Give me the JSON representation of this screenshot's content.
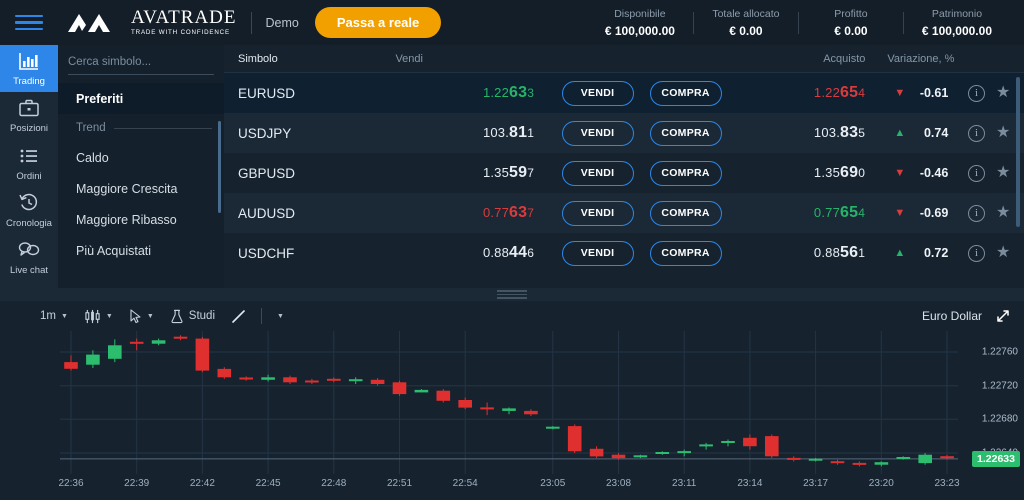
{
  "topbar": {
    "menu_icon": "hamburger-icon",
    "brand": "AVATRADE",
    "brand_tagline": "TRADE WITH CONFIDENCE",
    "account_mode": "Demo",
    "cta_label": "Passa a reale",
    "stats": [
      {
        "label": "Disponibile",
        "value": "€ 100,000.00"
      },
      {
        "label": "Totale allocato",
        "value": "€ 0.00"
      },
      {
        "label": "Profitto",
        "value": "€ 0.00"
      },
      {
        "label": "Patrimonio",
        "value": "€ 100,000.00"
      }
    ]
  },
  "leftnav": {
    "items": [
      {
        "label": "Trading",
        "icon": "bar-chart-icon",
        "active": true
      },
      {
        "label": "Posizioni",
        "icon": "briefcase-icon",
        "active": false
      },
      {
        "label": "Ordini",
        "icon": "list-icon",
        "active": false
      },
      {
        "label": "Cronologia",
        "icon": "history-clock-icon",
        "active": false
      }
    ],
    "chat": {
      "label": "Live chat",
      "icon": "chat-bubbles-icon"
    }
  },
  "watchlist": {
    "search_placeholder": "Cerca simbolo...",
    "search_value": "",
    "search_icon": "search-icon",
    "selected": "Preferiti",
    "group_label": "Trend",
    "items": [
      {
        "label": "Preferiti",
        "selected": true
      },
      {
        "label": "Caldo",
        "selected": false
      },
      {
        "label": "Maggiore Crescita",
        "selected": false
      },
      {
        "label": "Maggiore Ribasso",
        "selected": false
      },
      {
        "label": "Più Acquistati",
        "selected": false
      }
    ]
  },
  "quotes": {
    "headers": {
      "symbol": "Simbolo",
      "sell": "Vendi",
      "buy": "Acquisto",
      "change": "Variazione, %"
    },
    "sell_label": "VENDI",
    "buy_label": "COMPRA",
    "info_icon": "info-icon",
    "star_icon": "star-icon",
    "rows": [
      {
        "symbol": "EURUSD",
        "sell": {
          "pre": "1.22",
          "big": "63",
          "post": "3",
          "dir": "up"
        },
        "buy": {
          "pre": "1.22",
          "big": "65",
          "post": "4",
          "dir": "down"
        },
        "change": "-0.61",
        "change_dir": "down",
        "selected": true
      },
      {
        "symbol": "USDJPY",
        "sell": {
          "pre": "103.",
          "big": "81",
          "post": "1",
          "dir": "flat"
        },
        "buy": {
          "pre": "103.",
          "big": "83",
          "post": "5",
          "dir": "flat"
        },
        "change": "0.74",
        "change_dir": "up",
        "selected": false
      },
      {
        "symbol": "GBPUSD",
        "sell": {
          "pre": "1.35",
          "big": "59",
          "post": "7",
          "dir": "flat"
        },
        "buy": {
          "pre": "1.35",
          "big": "69",
          "post": "0",
          "dir": "flat"
        },
        "change": "-0.46",
        "change_dir": "down",
        "selected": false
      },
      {
        "symbol": "AUDUSD",
        "sell": {
          "pre": "0.77",
          "big": "63",
          "post": "7",
          "dir": "down"
        },
        "buy": {
          "pre": "0.77",
          "big": "65",
          "post": "4",
          "dir": "up"
        },
        "change": "-0.69",
        "change_dir": "down",
        "selected": false
      },
      {
        "symbol": "USDCHF",
        "sell": {
          "pre": "0.88",
          "big": "44",
          "post": "6",
          "dir": "flat"
        },
        "buy": {
          "pre": "0.88",
          "big": "56",
          "post": "1",
          "dir": "flat"
        },
        "change": "0.72",
        "change_dir": "up",
        "selected": false
      }
    ]
  },
  "chart_toolbar": {
    "timeframe": "1m",
    "chart_type_icon": "candlestick-icon",
    "cursor_icon": "cursor-arrow-icon",
    "studies_label": "Studi",
    "studies_icon": "flask-icon",
    "draw_icon": "trend-line-icon",
    "more_icon": "chevron-down-icon",
    "chart_title": "Euro Dollar",
    "expand_icon": "expand-icon"
  },
  "colors": {
    "accent": "#2e87e8",
    "cta": "#f2a000",
    "up": "#27b36a",
    "down": "#d83c3c",
    "badge": "#2dbd6e",
    "bg": "#16232f",
    "panel": "#1b2836"
  },
  "chart_data": {
    "type": "candlestick",
    "title": "Euro Dollar",
    "symbol": "EURUSD",
    "timeframe": "1m",
    "xlabel": "",
    "ylabel": "",
    "ylim": [
      1.22615,
      1.22785
    ],
    "y_ticks": [
      "1.22760",
      "1.22720",
      "1.22680",
      "1.22640"
    ],
    "y_tick_values": [
      1.2276,
      1.2272,
      1.2268,
      1.2264
    ],
    "current_price": "1.22633",
    "current_price_value": 1.22633,
    "grid": true,
    "x_ticks": [
      "22:36",
      "22:39",
      "22:42",
      "22:45",
      "22:48",
      "22:51",
      "22:54",
      "23:05",
      "23:08",
      "23:11",
      "23:14",
      "23:17",
      "23:20",
      "23:23"
    ],
    "candles": [
      {
        "t": "22:36",
        "o": 1.22748,
        "h": 1.22756,
        "l": 1.22738,
        "c": 1.2274
      },
      {
        "t": "22:37",
        "o": 1.22745,
        "h": 1.22762,
        "l": 1.22741,
        "c": 1.22757
      },
      {
        "t": "22:38",
        "o": 1.22752,
        "h": 1.22775,
        "l": 1.22748,
        "c": 1.22768
      },
      {
        "t": "22:39",
        "o": 1.22772,
        "h": 1.22776,
        "l": 1.22762,
        "c": 1.2277
      },
      {
        "t": "22:40",
        "o": 1.2277,
        "h": 1.22776,
        "l": 1.22768,
        "c": 1.22774
      },
      {
        "t": "22:41",
        "o": 1.22778,
        "h": 1.2278,
        "l": 1.22774,
        "c": 1.22776
      },
      {
        "t": "22:42",
        "o": 1.22776,
        "h": 1.22778,
        "l": 1.22736,
        "c": 1.22738
      },
      {
        "t": "22:43",
        "o": 1.2274,
        "h": 1.22742,
        "l": 1.22728,
        "c": 1.2273
      },
      {
        "t": "22:44",
        "o": 1.22729,
        "h": 1.22731,
        "l": 1.22726,
        "c": 1.22728
      },
      {
        "t": "22:45",
        "o": 1.22727,
        "h": 1.22733,
        "l": 1.22725,
        "c": 1.2273
      },
      {
        "t": "22:46",
        "o": 1.2273,
        "h": 1.22732,
        "l": 1.22722,
        "c": 1.22724
      },
      {
        "t": "22:47",
        "o": 1.22726,
        "h": 1.22728,
        "l": 1.22722,
        "c": 1.22724
      },
      {
        "t": "22:48",
        "o": 1.22728,
        "h": 1.2273,
        "l": 1.22724,
        "c": 1.22726
      },
      {
        "t": "22:49",
        "o": 1.22726,
        "h": 1.2273,
        "l": 1.22722,
        "c": 1.22727
      },
      {
        "t": "22:50",
        "o": 1.22727,
        "h": 1.22729,
        "l": 1.2272,
        "c": 1.22722
      },
      {
        "t": "22:51",
        "o": 1.22724,
        "h": 1.22726,
        "l": 1.22708,
        "c": 1.2271
      },
      {
        "t": "22:52",
        "o": 1.22712,
        "h": 1.22716,
        "l": 1.22712,
        "c": 1.22715
      },
      {
        "t": "22:53",
        "o": 1.22714,
        "h": 1.22716,
        "l": 1.227,
        "c": 1.22702
      },
      {
        "t": "22:54",
        "o": 1.22703,
        "h": 1.22706,
        "l": 1.22692,
        "c": 1.22694
      },
      {
        "t": "22:55",
        "o": 1.22694,
        "h": 1.227,
        "l": 1.22685,
        "c": 1.22692
      },
      {
        "t": "22:56",
        "o": 1.2269,
        "h": 1.22694,
        "l": 1.22686,
        "c": 1.22693
      },
      {
        "t": "22:57",
        "o": 1.2269,
        "h": 1.22692,
        "l": 1.22684,
        "c": 1.22686
      },
      {
        "t": "23:05",
        "o": 1.2267,
        "h": 1.22672,
        "l": 1.22668,
        "c": 1.2267
      },
      {
        "t": "23:06",
        "o": 1.22672,
        "h": 1.22674,
        "l": 1.2264,
        "c": 1.22642
      },
      {
        "t": "23:07",
        "o": 1.22645,
        "h": 1.22648,
        "l": 1.22634,
        "c": 1.22636
      },
      {
        "t": "23:08",
        "o": 1.22638,
        "h": 1.2264,
        "l": 1.22632,
        "c": 1.22634
      },
      {
        "t": "23:09",
        "o": 1.22636,
        "h": 1.22638,
        "l": 1.22634,
        "c": 1.22636
      },
      {
        "t": "23:10",
        "o": 1.2264,
        "h": 1.22642,
        "l": 1.22638,
        "c": 1.2264
      },
      {
        "t": "23:11",
        "o": 1.2264,
        "h": 1.22644,
        "l": 1.22636,
        "c": 1.22642
      },
      {
        "t": "23:12",
        "o": 1.22648,
        "h": 1.22652,
        "l": 1.22644,
        "c": 1.2265
      },
      {
        "t": "23:13",
        "o": 1.22652,
        "h": 1.22656,
        "l": 1.22648,
        "c": 1.22654
      },
      {
        "t": "23:14",
        "o": 1.22658,
        "h": 1.22662,
        "l": 1.22644,
        "c": 1.22648
      },
      {
        "t": "23:15",
        "o": 1.2266,
        "h": 1.22662,
        "l": 1.22634,
        "c": 1.22636
      },
      {
        "t": "23:16",
        "o": 1.22634,
        "h": 1.22636,
        "l": 1.2263,
        "c": 1.22632
      },
      {
        "t": "23:17",
        "o": 1.22632,
        "h": 1.22634,
        "l": 1.2263,
        "c": 1.22632
      },
      {
        "t": "23:18",
        "o": 1.2263,
        "h": 1.22632,
        "l": 1.22626,
        "c": 1.22628
      },
      {
        "t": "23:19",
        "o": 1.22628,
        "h": 1.2263,
        "l": 1.22624,
        "c": 1.22626
      },
      {
        "t": "23:20",
        "o": 1.22626,
        "h": 1.2263,
        "l": 1.22624,
        "c": 1.22629
      },
      {
        "t": "23:21",
        "o": 1.22634,
        "h": 1.22636,
        "l": 1.22632,
        "c": 1.22634
      },
      {
        "t": "23:22",
        "o": 1.22628,
        "h": 1.2264,
        "l": 1.22626,
        "c": 1.22638
      },
      {
        "t": "23:23",
        "o": 1.22636,
        "h": 1.22638,
        "l": 1.22632,
        "c": 1.22634
      }
    ]
  }
}
